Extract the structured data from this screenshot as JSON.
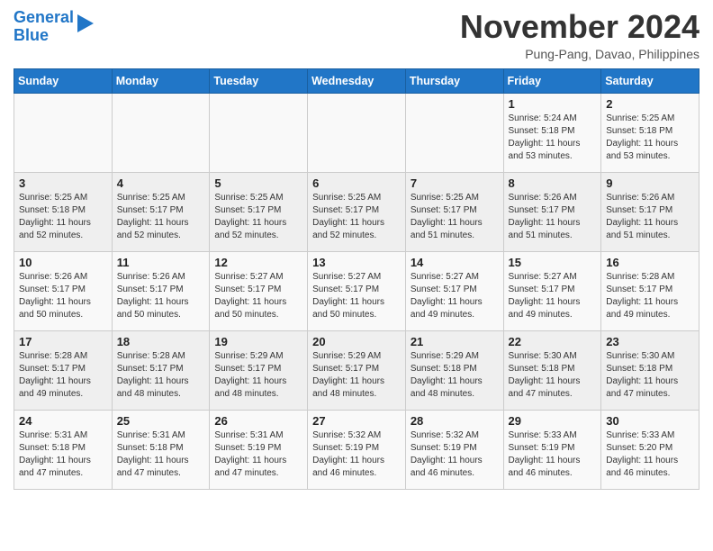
{
  "header": {
    "logo_line1": "General",
    "logo_line2": "Blue",
    "month": "November 2024",
    "location": "Pung-Pang, Davao, Philippines"
  },
  "weekdays": [
    "Sunday",
    "Monday",
    "Tuesday",
    "Wednesday",
    "Thursday",
    "Friday",
    "Saturday"
  ],
  "weeks": [
    [
      {
        "day": "",
        "info": ""
      },
      {
        "day": "",
        "info": ""
      },
      {
        "day": "",
        "info": ""
      },
      {
        "day": "",
        "info": ""
      },
      {
        "day": "",
        "info": ""
      },
      {
        "day": "1",
        "info": "Sunrise: 5:24 AM\nSunset: 5:18 PM\nDaylight: 11 hours\nand 53 minutes."
      },
      {
        "day": "2",
        "info": "Sunrise: 5:25 AM\nSunset: 5:18 PM\nDaylight: 11 hours\nand 53 minutes."
      }
    ],
    [
      {
        "day": "3",
        "info": "Sunrise: 5:25 AM\nSunset: 5:18 PM\nDaylight: 11 hours\nand 52 minutes."
      },
      {
        "day": "4",
        "info": "Sunrise: 5:25 AM\nSunset: 5:17 PM\nDaylight: 11 hours\nand 52 minutes."
      },
      {
        "day": "5",
        "info": "Sunrise: 5:25 AM\nSunset: 5:17 PM\nDaylight: 11 hours\nand 52 minutes."
      },
      {
        "day": "6",
        "info": "Sunrise: 5:25 AM\nSunset: 5:17 PM\nDaylight: 11 hours\nand 52 minutes."
      },
      {
        "day": "7",
        "info": "Sunrise: 5:25 AM\nSunset: 5:17 PM\nDaylight: 11 hours\nand 51 minutes."
      },
      {
        "day": "8",
        "info": "Sunrise: 5:26 AM\nSunset: 5:17 PM\nDaylight: 11 hours\nand 51 minutes."
      },
      {
        "day": "9",
        "info": "Sunrise: 5:26 AM\nSunset: 5:17 PM\nDaylight: 11 hours\nand 51 minutes."
      }
    ],
    [
      {
        "day": "10",
        "info": "Sunrise: 5:26 AM\nSunset: 5:17 PM\nDaylight: 11 hours\nand 50 minutes."
      },
      {
        "day": "11",
        "info": "Sunrise: 5:26 AM\nSunset: 5:17 PM\nDaylight: 11 hours\nand 50 minutes."
      },
      {
        "day": "12",
        "info": "Sunrise: 5:27 AM\nSunset: 5:17 PM\nDaylight: 11 hours\nand 50 minutes."
      },
      {
        "day": "13",
        "info": "Sunrise: 5:27 AM\nSunset: 5:17 PM\nDaylight: 11 hours\nand 50 minutes."
      },
      {
        "day": "14",
        "info": "Sunrise: 5:27 AM\nSunset: 5:17 PM\nDaylight: 11 hours\nand 49 minutes."
      },
      {
        "day": "15",
        "info": "Sunrise: 5:27 AM\nSunset: 5:17 PM\nDaylight: 11 hours\nand 49 minutes."
      },
      {
        "day": "16",
        "info": "Sunrise: 5:28 AM\nSunset: 5:17 PM\nDaylight: 11 hours\nand 49 minutes."
      }
    ],
    [
      {
        "day": "17",
        "info": "Sunrise: 5:28 AM\nSunset: 5:17 PM\nDaylight: 11 hours\nand 49 minutes."
      },
      {
        "day": "18",
        "info": "Sunrise: 5:28 AM\nSunset: 5:17 PM\nDaylight: 11 hours\nand 48 minutes."
      },
      {
        "day": "19",
        "info": "Sunrise: 5:29 AM\nSunset: 5:17 PM\nDaylight: 11 hours\nand 48 minutes."
      },
      {
        "day": "20",
        "info": "Sunrise: 5:29 AM\nSunset: 5:17 PM\nDaylight: 11 hours\nand 48 minutes."
      },
      {
        "day": "21",
        "info": "Sunrise: 5:29 AM\nSunset: 5:18 PM\nDaylight: 11 hours\nand 48 minutes."
      },
      {
        "day": "22",
        "info": "Sunrise: 5:30 AM\nSunset: 5:18 PM\nDaylight: 11 hours\nand 47 minutes."
      },
      {
        "day": "23",
        "info": "Sunrise: 5:30 AM\nSunset: 5:18 PM\nDaylight: 11 hours\nand 47 minutes."
      }
    ],
    [
      {
        "day": "24",
        "info": "Sunrise: 5:31 AM\nSunset: 5:18 PM\nDaylight: 11 hours\nand 47 minutes."
      },
      {
        "day": "25",
        "info": "Sunrise: 5:31 AM\nSunset: 5:18 PM\nDaylight: 11 hours\nand 47 minutes."
      },
      {
        "day": "26",
        "info": "Sunrise: 5:31 AM\nSunset: 5:19 PM\nDaylight: 11 hours\nand 47 minutes."
      },
      {
        "day": "27",
        "info": "Sunrise: 5:32 AM\nSunset: 5:19 PM\nDaylight: 11 hours\nand 46 minutes."
      },
      {
        "day": "28",
        "info": "Sunrise: 5:32 AM\nSunset: 5:19 PM\nDaylight: 11 hours\nand 46 minutes."
      },
      {
        "day": "29",
        "info": "Sunrise: 5:33 AM\nSunset: 5:19 PM\nDaylight: 11 hours\nand 46 minutes."
      },
      {
        "day": "30",
        "info": "Sunrise: 5:33 AM\nSunset: 5:20 PM\nDaylight: 11 hours\nand 46 minutes."
      }
    ]
  ]
}
